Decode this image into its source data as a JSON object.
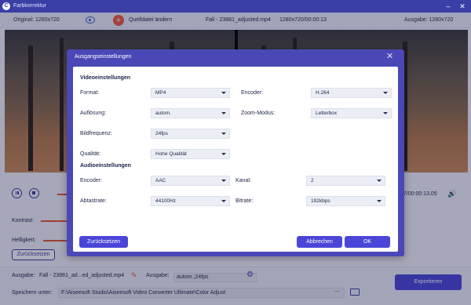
{
  "window": {
    "title": "Farbkorrektur",
    "logo": "C",
    "minimize_icon": "–",
    "close_icon": "✕"
  },
  "infostrip": {
    "original_label": "Original: 1280x720",
    "change_source_label": "Quelldatei ändern",
    "add_icon": "+",
    "file_name": "Fall - 23881_adjusted.mp4",
    "file_info": "1280x720/00:00:13",
    "output_label": "Ausgabe: 1280x720"
  },
  "player": {
    "time": "17/00:00:13.05",
    "volume_icon": "🔊"
  },
  "adjust": {
    "contrast_label": "Kontrast:",
    "brightness_label": "Helligkeit:",
    "reset_label": "Zurücksetzen"
  },
  "bottom": {
    "output_label": "Ausgabe:",
    "output_file": "Fall - 23881_ad...ed_adjusted.mp4",
    "edit_icon": "✎",
    "output_format_label": "Ausgabe:",
    "output_format_value": "autom.;24fps",
    "gear_icon": "⚙",
    "save_label": "Speichern unter:",
    "save_path": "F:\\Aiseesoft Studio\\Aiseesoft Video Converter Ultimate\\Color Adjust",
    "browse_label": "···",
    "export_label": "Exportieren"
  },
  "dialog": {
    "title": "Ausgangseinstellungen",
    "close_icon": "✕",
    "video_section": "Videoeinstellungen",
    "audio_section": "Audioeinstellungen",
    "format_label": "Format:",
    "format_value": "MP4",
    "encoder_label": "Encoder:",
    "encoder_value": "H.264",
    "resolution_label": "Auflösung:",
    "resolution_value": "autom.",
    "zoom_label": "Zoom-Modus:",
    "zoom_value": "Letterbox",
    "framerate_label": "Bildfrequenz:",
    "framerate_value": "24fps",
    "quality_label": "Qualität:",
    "quality_value": "Hohe Qualität",
    "aencoder_label": "Encoder:",
    "aencoder_value": "AAC",
    "channel_label": "Kanal:",
    "channel_value": "2",
    "samplerate_label": "Abtastrate:",
    "samplerate_value": "44100Hz",
    "bitrate_label": "Bitrate:",
    "bitrate_value": "192kbps",
    "reset_label": "Zurücksetzen",
    "cancel_label": "Abbrechen",
    "ok_label": "OK"
  },
  "colors": {
    "accent": "#4a46d8",
    "titlebar": "#3a3fa5",
    "dialog_frame": "#4a47b6",
    "slider": "#e4572e"
  }
}
